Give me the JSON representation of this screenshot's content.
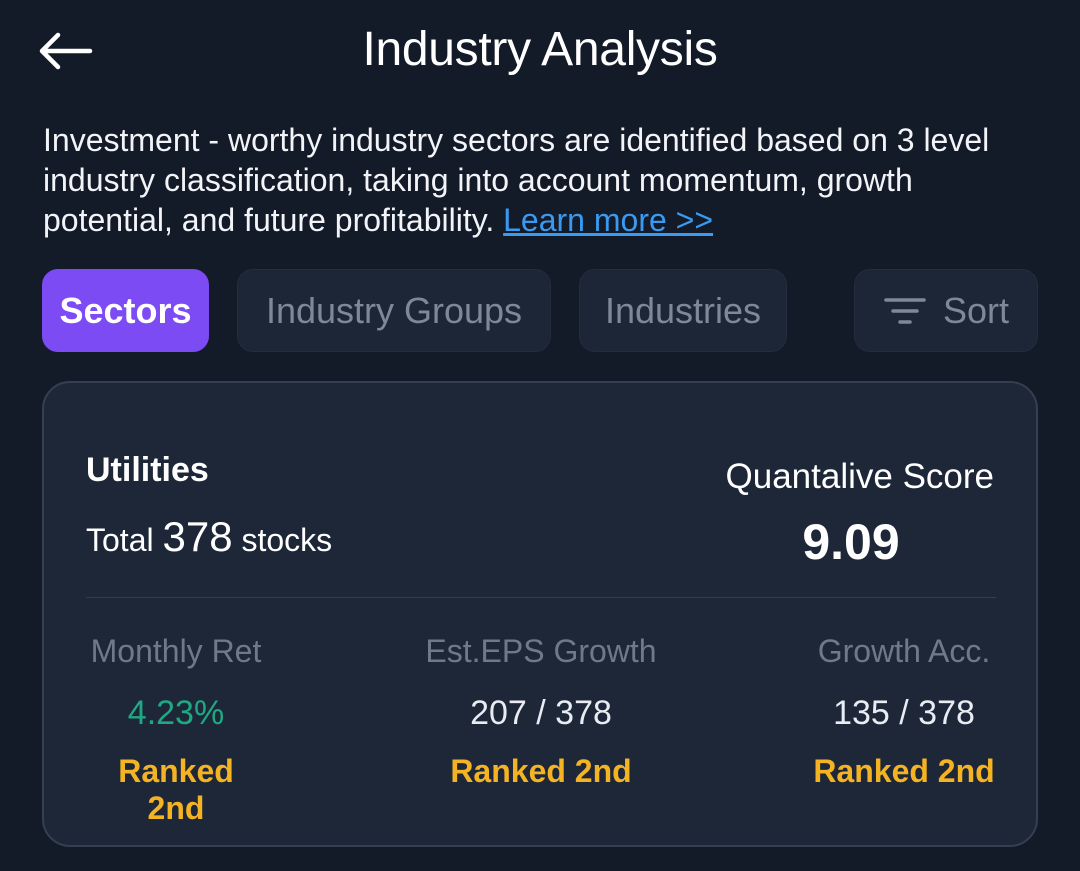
{
  "header": {
    "title": "Industry Analysis",
    "back_icon": "arrow-left-icon"
  },
  "description": {
    "text": "Investment - worthy industry sectors are identified based on 3 level industry classification, taking into account momentum, growth potential, and future profitability. ",
    "link": "Learn more >>"
  },
  "tabs": [
    {
      "label": "Sectors",
      "active": true
    },
    {
      "label": "Industry Groups",
      "active": false
    },
    {
      "label": "Industries",
      "active": false
    }
  ],
  "sort": {
    "label": "Sort",
    "icon": "filter-icon"
  },
  "card": {
    "sector": "Utilities",
    "total_prefix": "Total",
    "total_count": "378",
    "total_suffix": "stocks",
    "score_label": "Quantalive Score",
    "score_value": "9.09",
    "metrics": [
      {
        "label": "Monthly Ret",
        "value": "4.23%",
        "rank": "Ranked 2nd"
      },
      {
        "label": "Est.EPS Growth",
        "value": "207 / 378",
        "rank": "Ranked 2nd"
      },
      {
        "label": "Growth Acc.",
        "value": "135 / 378",
        "rank": "Ranked 2nd"
      }
    ]
  },
  "colors": {
    "background": "#131a28",
    "card": "#1e2738",
    "accent": "#7c4bf3",
    "link": "#3a9af2",
    "positive": "#1ea983",
    "rank": "#f3b322"
  }
}
